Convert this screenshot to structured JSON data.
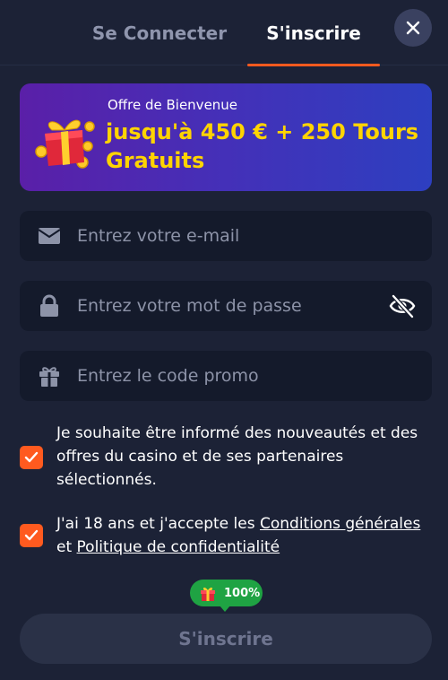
{
  "tabs": {
    "login": "Se Connecter",
    "register": "S'inscrire",
    "active": "register"
  },
  "banner": {
    "subtitle": "Offre de Bienvenue",
    "title": "jusqu'à 450 € + 250 Tours Gratuits"
  },
  "fields": {
    "email_placeholder": "Entrez votre e-mail",
    "password_placeholder": "Entrez votre mot de passe",
    "promo_placeholder": "Entrez le code promo"
  },
  "checkboxes": {
    "newsletter": {
      "checked": true,
      "label": "Je souhaite être informé des nouveautés et des offres du casino et de ses partenaires sélectionnés."
    },
    "terms": {
      "checked": true,
      "prefix": "J'ai 18 ans et j'accepte les ",
      "link_terms": "Conditions générales",
      "middle": " et ",
      "link_privacy": "Politique de confidentialité"
    }
  },
  "progress": {
    "value": "100%"
  },
  "submit": {
    "label": "S'inscrire"
  },
  "colors": {
    "accent": "#ff5a1f",
    "banner_text": "#ffd400",
    "success": "#1fa343"
  }
}
